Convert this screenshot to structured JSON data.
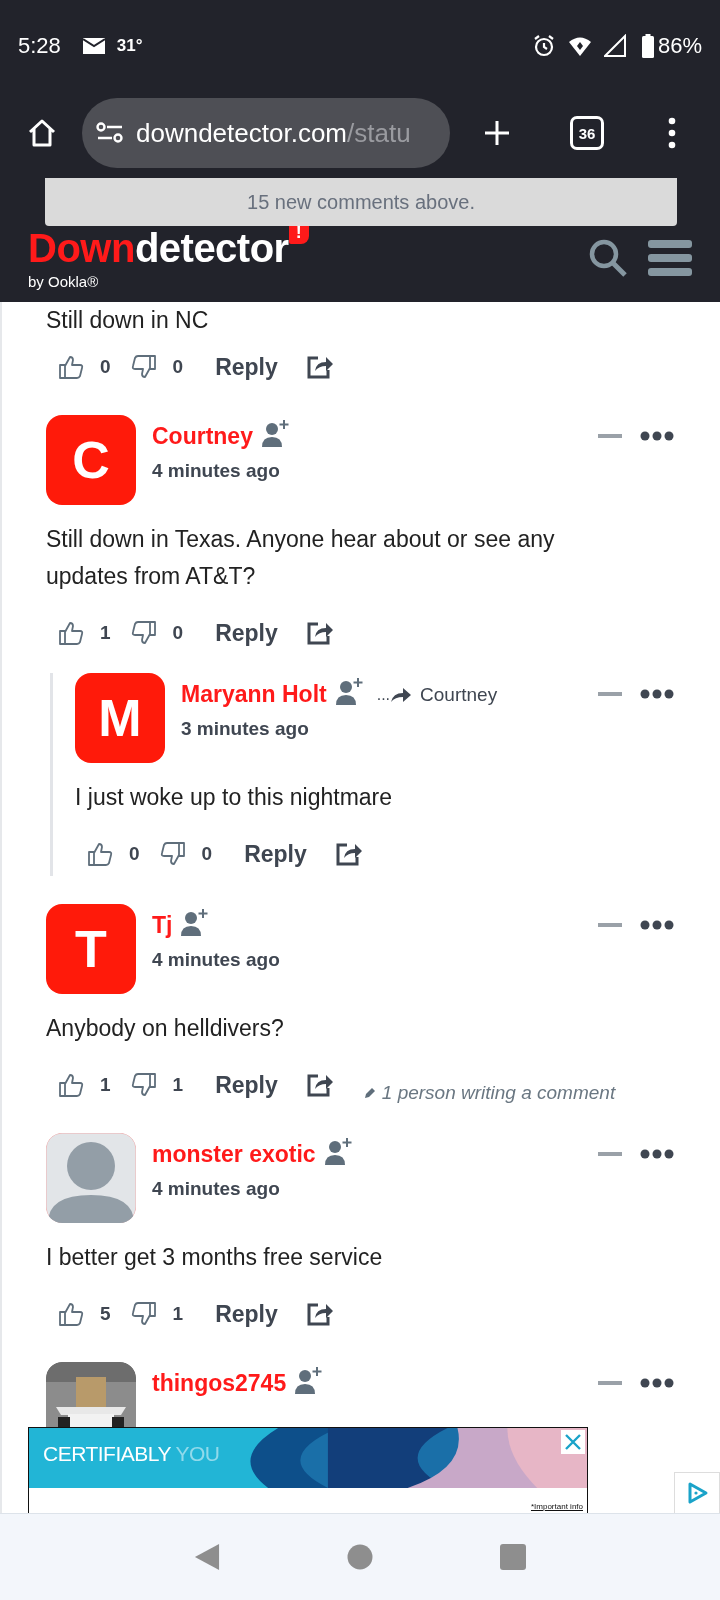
{
  "status_bar": {
    "time": "5:28",
    "temperature": "31°",
    "battery": "86%"
  },
  "browser": {
    "url_host": "downdetector.com",
    "url_path": "/statu",
    "tab_count": "36"
  },
  "toast": "15 new comments above.",
  "site_header": {
    "logo_red": "Down",
    "logo_white": "detector",
    "logo_mark": "!",
    "byline": "by Ookla®"
  },
  "comments": [
    {
      "avatar": {
        "kind": "none"
      },
      "text": "Still down in NC",
      "likes": "0",
      "dislikes": "0",
      "reply": "Reply"
    },
    {
      "author": "Courtney",
      "time": "4 minutes ago",
      "avatar": {
        "kind": "letter",
        "letter": "C"
      },
      "text": "Still down in Texas. Anyone hear about or see any updates from AT&T?",
      "likes": "1",
      "dislikes": "0",
      "reply": "Reply",
      "children": [
        {
          "author": "Maryann Holt",
          "reply_to_prefix": "...",
          "reply_to": "Courtney",
          "time": "3 minutes ago",
          "avatar": {
            "kind": "letter",
            "letter": "M"
          },
          "text": "I just woke up to this nightmare",
          "likes": "0",
          "dislikes": "0",
          "reply": "Reply"
        }
      ]
    },
    {
      "author": "Tj",
      "time": "4 minutes ago",
      "avatar": {
        "kind": "letter",
        "letter": "T"
      },
      "text": "Anybody on helldivers?",
      "likes": "1",
      "dislikes": "1",
      "reply": "Reply",
      "writing": "1 person writing a comment"
    },
    {
      "author": "monster exotic",
      "time": "4 minutes ago",
      "avatar": {
        "kind": "default"
      },
      "text": "I better get 3 months free service",
      "likes": "5",
      "dislikes": "1",
      "reply": "Reply"
    },
    {
      "author": "thingos2745"
    }
  ],
  "ad": {
    "headline_bright": "CERTIFIABLY",
    "headline_dim": "YOU",
    "footnote": "*Important info"
  }
}
